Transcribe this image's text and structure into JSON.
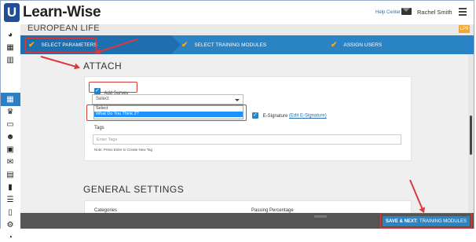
{
  "app": {
    "logo_letter": "U",
    "name": "Learn-Wise",
    "help_link": "Help Center",
    "user_name": "Rachel Smith"
  },
  "page": {
    "title": "EUROPEAN LIFE",
    "badge": "LP9"
  },
  "steps": [
    {
      "label": "SELECT PARAMETERS",
      "done": true
    },
    {
      "label": "SELECT TRAINING MODULES",
      "done": true
    },
    {
      "label": "ASSIGN USERS",
      "done": true
    }
  ],
  "attach": {
    "title": "ATTACH",
    "add_survey_label": "Add Survey",
    "add_survey_checked": true,
    "survey_select_value": "Select",
    "dropdown_options": [
      "Select",
      "What Do You Think 2?"
    ],
    "dropdown_highlighted": "What Do You Think 2?",
    "esignature_label": "E-Signature",
    "esignature_link": "(Edit E-Signature)",
    "esignature_checked": true,
    "tags_label": "Tags",
    "tags_placeholder": "Enter Tags",
    "tags_note": "Note: Press Enter to Create New Tag"
  },
  "general_settings": {
    "title": "GENERAL SETTINGS",
    "categories_label": "Categories",
    "passing_label": "Passing Percentage"
  },
  "footer": {
    "save_prefix": "SAVE & NEXT:",
    "save_target": "TRAINING MODULES"
  },
  "sidebar": {
    "icons": [
      "dashboard-icon",
      "book-icon",
      "library-icon",
      "grid-icon",
      "trophy-icon",
      "presentation-icon",
      "users-icon",
      "user-certificate-icon",
      "mail-icon",
      "calendar-icon",
      "report-icon",
      "checklist-icon",
      "tablet-icon",
      "settings-icon",
      "pie-chart-icon"
    ],
    "active": "grid-icon"
  },
  "colors": {
    "primary": "#2a83c5",
    "accent": "#f5a623",
    "annotation": "#d93a3a",
    "footer": "#555555"
  }
}
